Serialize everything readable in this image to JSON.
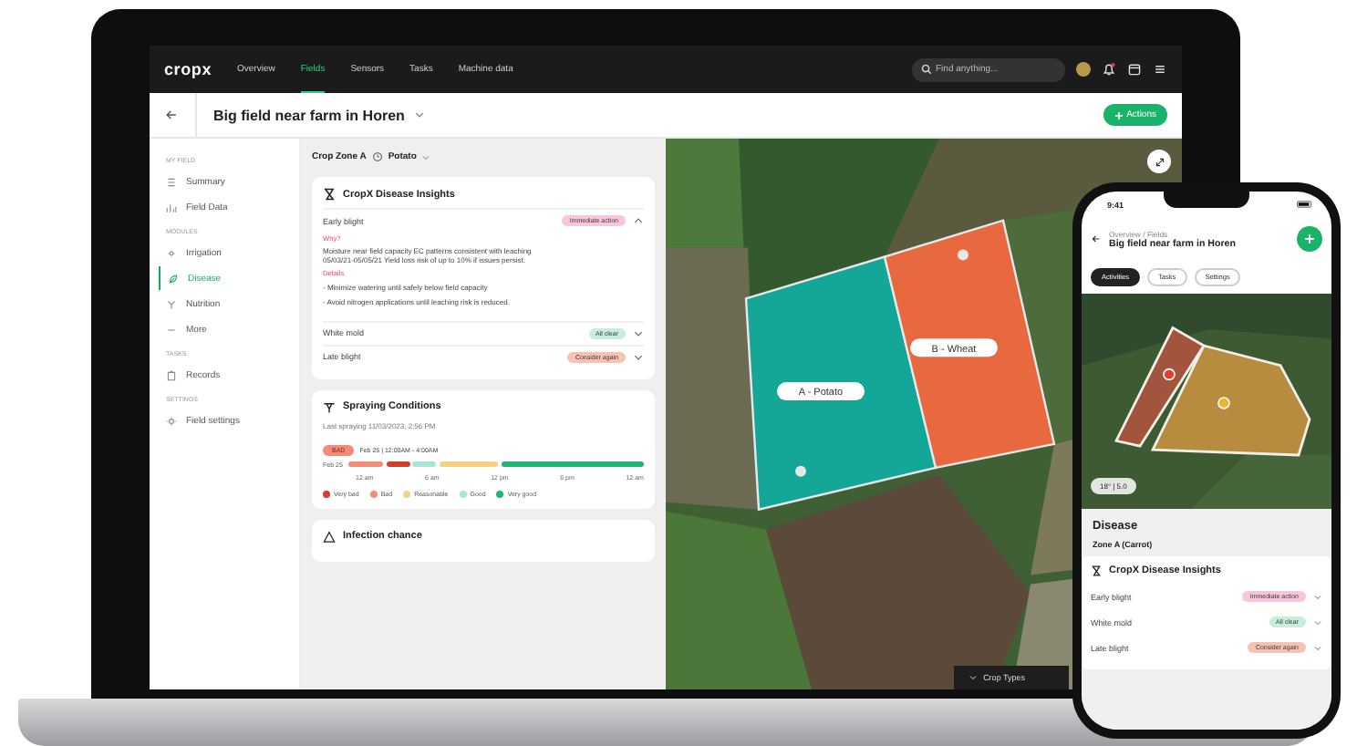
{
  "laptop": {
    "logo": "cropx",
    "nav": [
      {
        "label": "Overview",
        "selected": false
      },
      {
        "label": "Fields",
        "selected": true
      },
      {
        "label": "Sensors",
        "selected": false
      },
      {
        "label": "Tasks",
        "selected": false
      },
      {
        "label": "Machine data",
        "selected": false
      }
    ],
    "search": {
      "placeholder": "Find anything..."
    },
    "page_title": "Big field near farm in Horen",
    "actions_button": "Actions",
    "sidebar": [
      {
        "heading": "MY FIELD",
        "items": [
          {
            "label": "Summary",
            "selected": false
          },
          {
            "label": "Field Data",
            "selected": false
          }
        ]
      },
      {
        "heading": "MODULES",
        "items": [
          {
            "label": "Irrigation",
            "selected": false
          },
          {
            "label": "Disease",
            "selected": true
          },
          {
            "label": "Nutrition",
            "selected": false
          },
          {
            "label": "More",
            "selected": false
          }
        ]
      },
      {
        "heading": "TASKS",
        "items": [
          {
            "label": "Records",
            "selected": false
          }
        ]
      },
      {
        "heading": "SETTINGS",
        "items": [
          {
            "label": "Field settings",
            "selected": false
          }
        ]
      }
    ],
    "zone_selector": "Crop Zone A",
    "crop": "Potato",
    "disease_card": {
      "title": "CropX Disease Insights",
      "rows": [
        {
          "name": "Early blight",
          "badge": "Immediate action",
          "color": "#f7c6dc",
          "expanded": true,
          "why_label": "Why?",
          "why_text": "Moisture near field capacity EC patterns consistent with leaching 05/03/21-05/05/21 Yield loss risk of up to 10% if issues persist.",
          "details_label": "Details",
          "details": [
            "- Minimize watering until safely below field capacity",
            "- Avoid nitrogen applications until leaching risk is reduced."
          ]
        },
        {
          "name": "White mold",
          "badge": "All clear",
          "color": "#c6eedb",
          "expanded": false
        },
        {
          "name": "Late blight",
          "badge": "Consider again",
          "color": "#f8c2b3",
          "expanded": false
        }
      ]
    },
    "spraying": {
      "title": "Spraying Conditions",
      "subtitle": "Last spraying 11/03/2023, 2:56 PM",
      "now_badge": "BAD",
      "range": "Feb 25 | 12:00AM - 4:00AM",
      "day": "Feb 25",
      "hours": [
        {
          "kind": "bad"
        },
        {
          "kind": "bad"
        },
        {
          "kind": "bad"
        },
        {
          "kind": "very_bad"
        },
        {
          "kind": "very_bad"
        },
        {
          "kind": "good"
        },
        {
          "kind": "good"
        },
        {
          "kind": "reasonable"
        },
        {
          "kind": "reasonable"
        },
        {
          "kind": "reasonable"
        },
        {
          "kind": "reasonable"
        },
        {
          "kind": "reasonable"
        },
        {
          "kind": "very_good"
        },
        {
          "kind": "very_good"
        },
        {
          "kind": "very_good"
        },
        {
          "kind": "very_good"
        },
        {
          "kind": "very_good"
        },
        {
          "kind": "very_good"
        },
        {
          "kind": "very_good"
        },
        {
          "kind": "very_good"
        },
        {
          "kind": "very_good"
        },
        {
          "kind": "very_good"
        },
        {
          "kind": "very_good"
        },
        {
          "kind": "very_good"
        }
      ],
      "ticks": [
        "12 am",
        "6 am",
        "12 pm",
        "6 pm",
        "12 am"
      ],
      "legend": [
        {
          "kind": "very_bad",
          "label": "Very bad",
          "color": "#cf3f2c"
        },
        {
          "kind": "bad",
          "label": "Bad",
          "color": "#f28b78"
        },
        {
          "kind": "reasonable",
          "label": "Reasonable",
          "color": "#f6d27e"
        },
        {
          "kind": "good",
          "label": "Good",
          "color": "#a6e6d2"
        },
        {
          "kind": "very_good",
          "label": "Very good",
          "color": "#22b573"
        }
      ]
    },
    "infection": {
      "title": "Infection chance"
    },
    "map": {
      "zones": [
        {
          "label": "A - Potato",
          "color": "#14a797"
        },
        {
          "label": "B - Wheat",
          "color": "#e8683f"
        }
      ],
      "crop_types_button": "Crop Types"
    }
  },
  "phone": {
    "time": "9:41",
    "breadcrumb": "Overview / Fields",
    "title": "Big field near farm in Horen",
    "chips": [
      {
        "label": "Activities",
        "selected": true
      },
      {
        "label": "Tasks",
        "selected": false
      },
      {
        "label": "Settings",
        "selected": false
      }
    ],
    "zones": [
      {
        "color": "#a3543c"
      },
      {
        "color": "#b88c3f"
      }
    ],
    "weather": "18° | 5.0",
    "sheet_title": "Disease",
    "zone_selector": "Zone A (Carrot)",
    "card_title": "CropX Disease Insights",
    "rows": [
      {
        "name": "Early blight",
        "badge": "Immediate action",
        "color": "#f7c6dc"
      },
      {
        "name": "White mold",
        "badge": "All clear",
        "color": "#c6eedb"
      },
      {
        "name": "Late blight",
        "badge": "Consider again",
        "color": "#f8c2b3"
      }
    ]
  }
}
